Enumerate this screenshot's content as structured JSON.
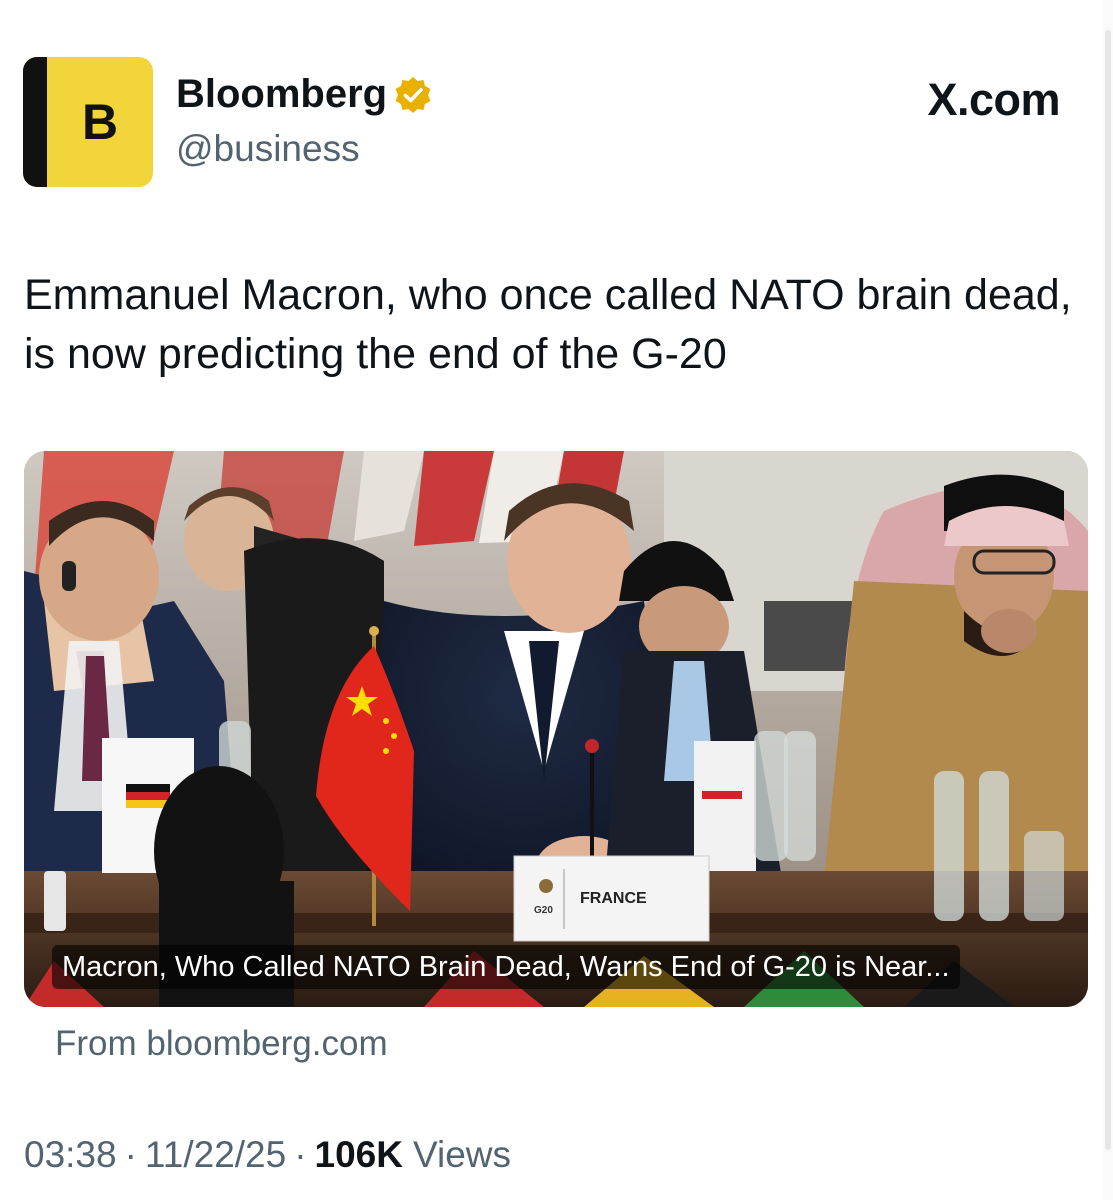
{
  "account": {
    "avatar_letter": "B",
    "display_name": "Bloomberg",
    "handle": "@business",
    "verified_badge": "gold-verified-icon"
  },
  "source_label": "X.com",
  "tweet_text": "Emmanuel Macron, who once called NATO brain dead, is now predicting the end of the G-20",
  "card": {
    "caption": "Macron, Who Called NATO Brain Dead, Warns End of G-20 is Near...",
    "placard_text": "FRANCE",
    "placard_logo": "G20",
    "from": "From bloomberg.com"
  },
  "meta": {
    "time": "03:38",
    "date": "11/22/25",
    "views_count": "106K",
    "views_label": "Views"
  },
  "colors": {
    "avatar_bg": "#f2d43b",
    "verified_gold": "#e8b100",
    "secondary_text": "#536471"
  }
}
